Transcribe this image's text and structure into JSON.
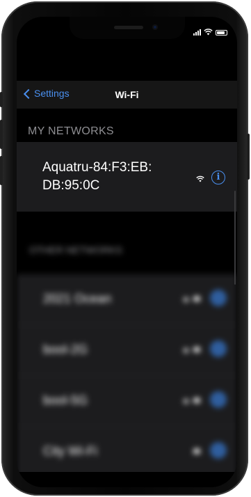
{
  "nav": {
    "back_label": "Settings",
    "title": "Wi-Fi"
  },
  "my_networks": {
    "header": "MY NETWORKS",
    "items": [
      {
        "name": "Aquatru-84:F3:EB: DB:95:0C"
      }
    ]
  },
  "other_networks": {
    "header": "OTHER NETWORKS",
    "items": [
      {
        "name": "2021 Ocean"
      },
      {
        "name": "bool-2G"
      },
      {
        "name": "bool-5G"
      },
      {
        "name": "City Wi-Fi"
      }
    ]
  },
  "colors": {
    "accent": "#4a90f0",
    "row_bg": "#1c1c1e",
    "nav_bg": "#161616"
  }
}
